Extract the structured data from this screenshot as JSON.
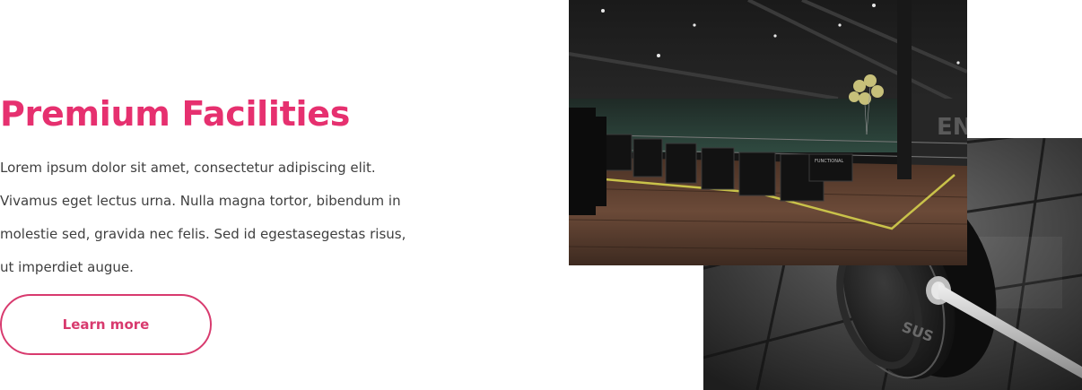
{
  "feature": {
    "title": "Premium Facilities",
    "body_lines": [
      "Lorem ipsum dolor sit amet, consectetur adipiscing elit.",
      "Vivamus eget lectus urna. Nulla magna tortor, bibendum in",
      "molestie sed, gravida nec felis. Sed id egestasegestas risus,",
      "ut imperdiet augue."
    ],
    "cta_label": "Learn more"
  },
  "colors": {
    "accent": "#e6306f",
    "button_border": "#d83a6e",
    "text": "#3f3f3f"
  },
  "images": {
    "gym_interior": {
      "sign_text": "FUNCTIONAL"
    },
    "barbell": {
      "plate_text": "SUS"
    }
  }
}
